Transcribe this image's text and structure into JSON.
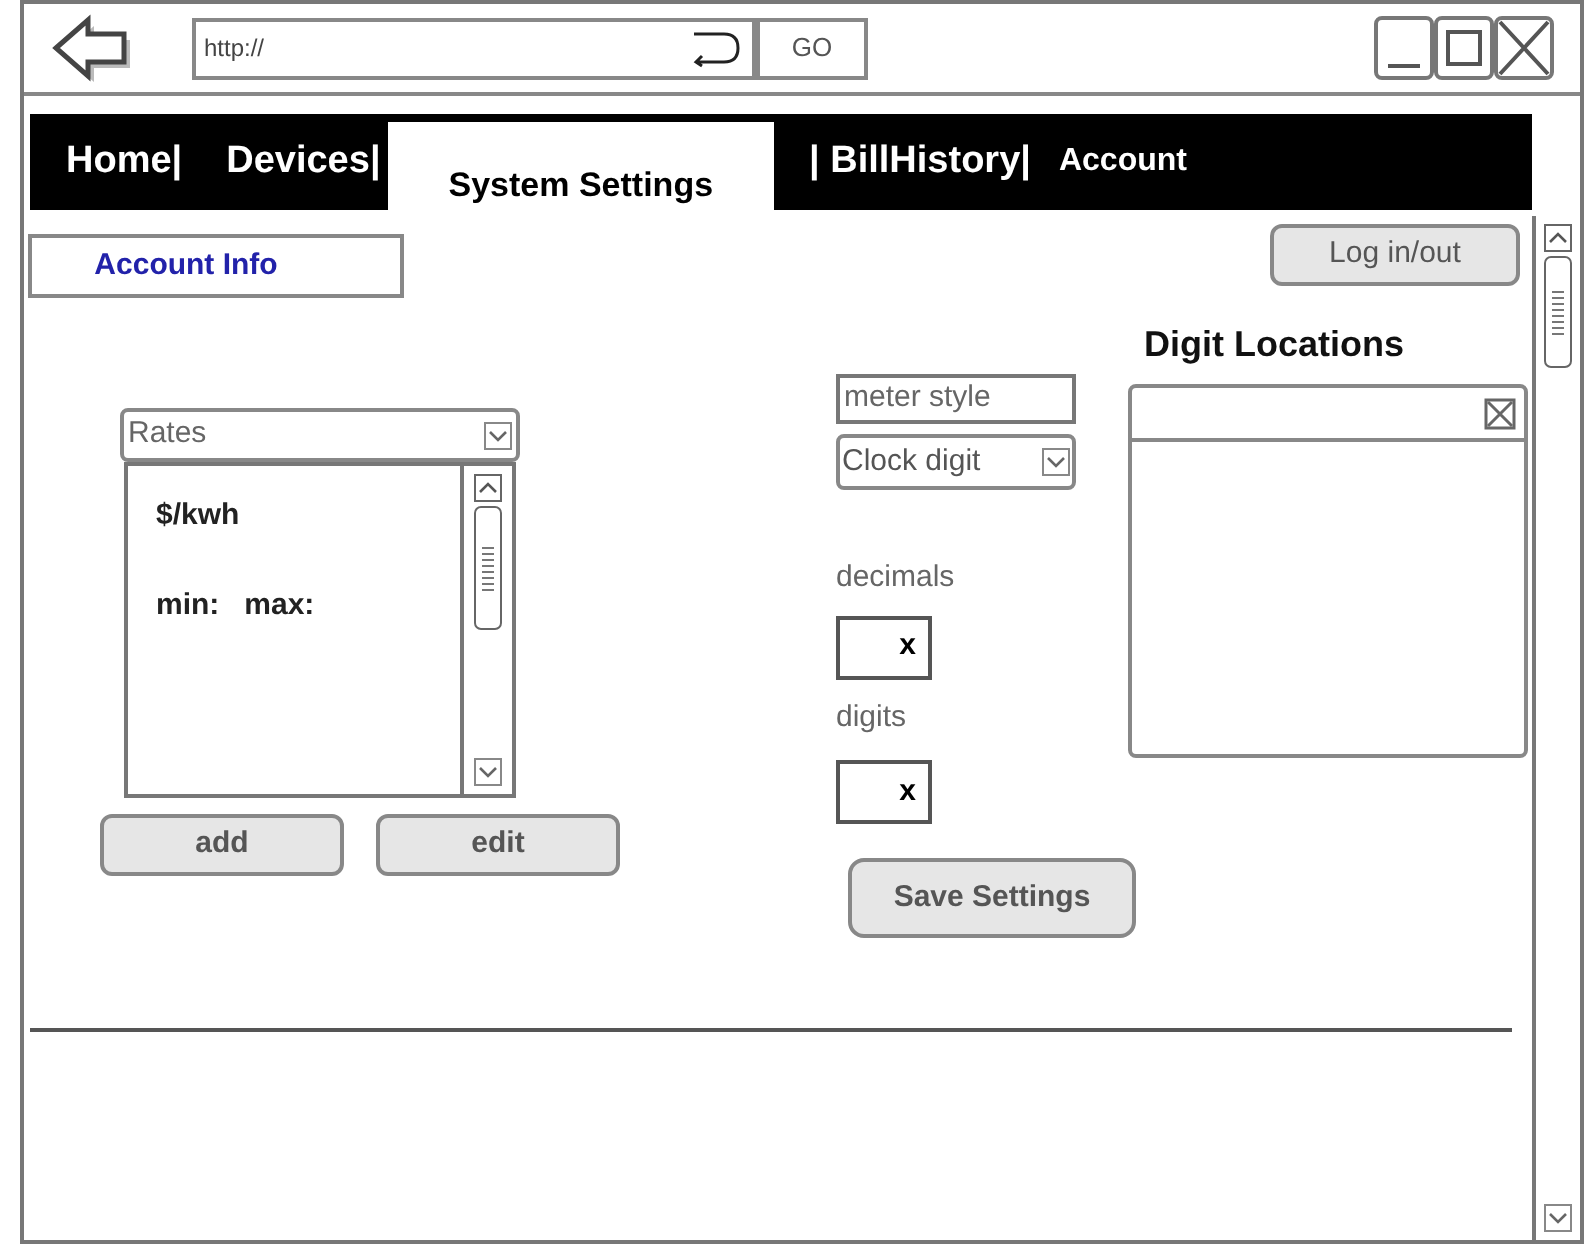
{
  "browser": {
    "url": "http://",
    "go_button": "GO"
  },
  "nav": {
    "tabs": [
      {
        "label": "Home|",
        "selected": false
      },
      {
        "label": "Devices|",
        "selected": false
      },
      {
        "label": "System Settings",
        "selected": true
      },
      {
        "label": "| BillHistory|",
        "selected": false
      },
      {
        "label": "Account",
        "selected": false
      }
    ]
  },
  "account_info": "Account Info",
  "login_button": "Log in/out",
  "rates": {
    "dropdown": "Rates",
    "items": [
      "$/kwh",
      "min:   max:"
    ],
    "buttons": [
      "add",
      "edit"
    ]
  },
  "meter": {
    "style_label": "meter style",
    "style_value": "Clock digit",
    "decimals_label": "decimals",
    "decimals_value": "x",
    "digits_label": "digits",
    "digits_value": "x",
    "save_button": "Save Settings"
  },
  "digit_locations": {
    "title": "Digit Locations"
  }
}
